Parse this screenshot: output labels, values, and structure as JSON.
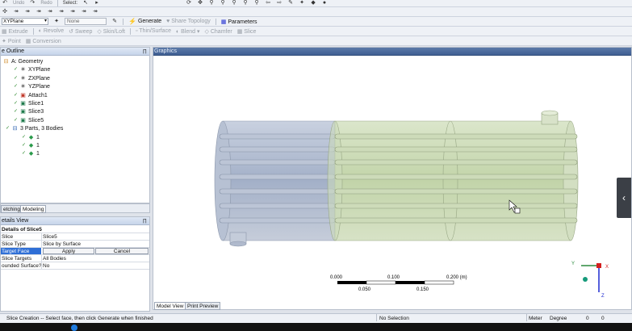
{
  "toolbar": {
    "undo_label": "Undo",
    "redo_label": "Redo",
    "select_label": "Select:",
    "plane_value": "XYPlane",
    "sketch_value": "None",
    "generate_label": "Generate",
    "share_topology_label": "Share Topology",
    "parameters_label": "Parameters",
    "extrude_label": "Extrude",
    "revolve_label": "Revolve",
    "sweep_label": "Sweep",
    "skin_loft_label": "Skin/Loft",
    "thin_surface_label": "Thin/Surface",
    "blend_label": "Blend",
    "chamfer_label": "Chamfer",
    "slice_label": "Slice",
    "point_label": "Point",
    "conversion_label": "Conversion"
  },
  "tree_panel": {
    "title": "e Outline",
    "pin": "!"
  },
  "tree": [
    {
      "label": "A: Geometry",
      "icon": "geometry-icon"
    },
    {
      "label": "XYPlane",
      "icon": "plane-icon"
    },
    {
      "label": "ZXPlane",
      "icon": "plane-icon"
    },
    {
      "label": "YZPlane",
      "icon": "plane-icon"
    },
    {
      "label": "Attach1",
      "icon": "attach-icon"
    },
    {
      "label": "Slice1",
      "icon": "slice-icon"
    },
    {
      "label": "Slice3",
      "icon": "slice-icon"
    },
    {
      "label": "Slice5",
      "icon": "slice-icon"
    },
    {
      "label": "3 Parts, 3 Bodies",
      "icon": "parts-icon"
    },
    {
      "label": "1",
      "icon": "body-icon"
    },
    {
      "label": "1",
      "icon": "body-icon"
    },
    {
      "label": "1",
      "icon": "body-icon"
    }
  ],
  "tabs": {
    "sketching": "etching",
    "modeling": "Modeling"
  },
  "details": {
    "title": "etails View",
    "header": "Details of Slice5",
    "rows": [
      {
        "key": "Slice",
        "value": "Slice5"
      },
      {
        "key": "Slice Type",
        "value": "Slice by Surface"
      },
      {
        "key": "Target Face",
        "value": ""
      },
      {
        "key": "Slice Targets",
        "value": "All Bodies"
      },
      {
        "key": "ounded Surface?",
        "value": "No"
      }
    ],
    "apply_label": "Apply",
    "cancel_label": "Cancel"
  },
  "graphics": {
    "title": "Graphics",
    "scale_top": [
      "0.000",
      "0.100",
      "0.200 (m)"
    ],
    "scale_bottom": [
      "0.050",
      "0.150"
    ],
    "axis_x": "X",
    "axis_y": "Y",
    "axis_z": "Z",
    "model_view_tab": "Model View",
    "print_preview_tab": "Print Preview"
  },
  "status": {
    "message": "Slice Creation -- Select face, then click Generate when finished",
    "selection": "No Selection",
    "units_length": "Meter",
    "units_angle": "Degree",
    "field1": "0",
    "field2": "0"
  },
  "colors": {
    "header_blue": "#4a6a9e",
    "body_blue": "#a9b5cc",
    "body_green": "#c6d7b0",
    "axis_red": "#d21f1f",
    "axis_green": "#2b8a3e",
    "axis_blue": "#1d2ad0"
  }
}
